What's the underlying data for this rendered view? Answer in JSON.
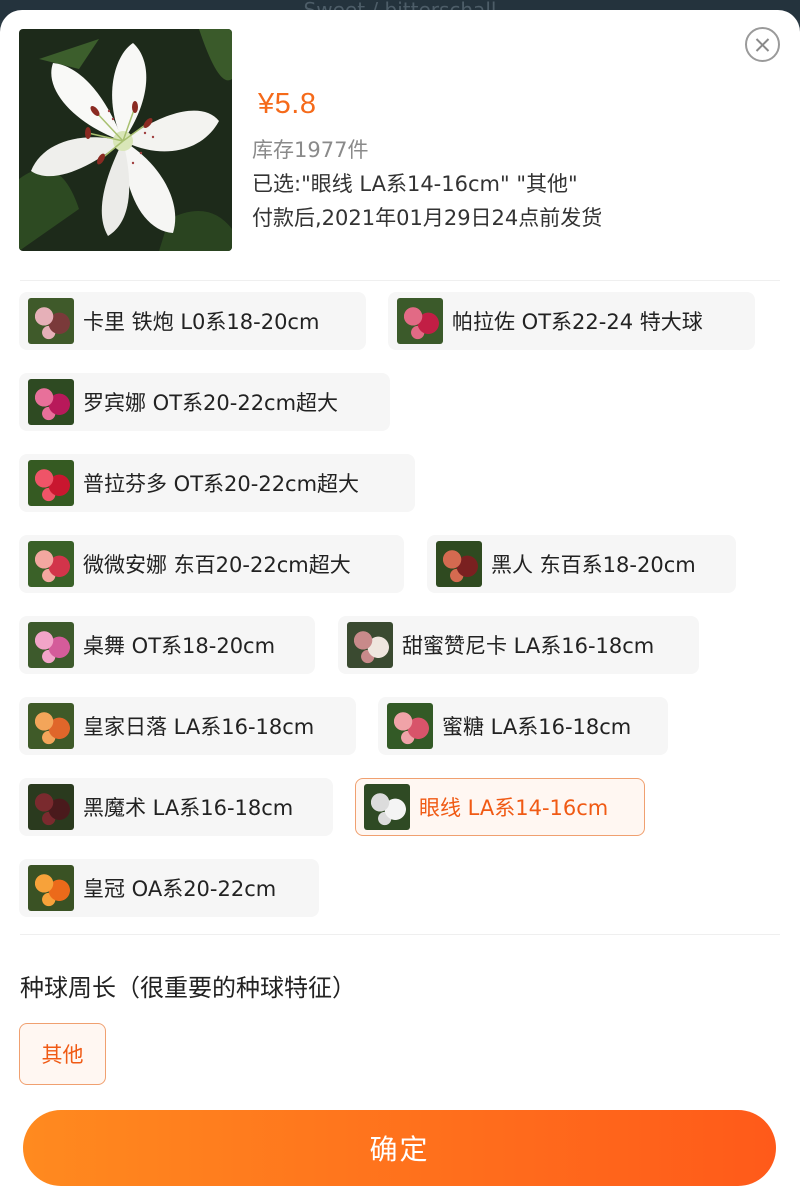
{
  "background": {
    "top_text": "Sweet / bitterschall"
  },
  "product": {
    "image": "white-lily-photo",
    "price": "¥5.8",
    "stock": "库存1977件",
    "selected": "已选:\"眼线 LA系14-16cm\" \"其他\"",
    "shipping": "付款后,2021年01月29日24点前发货"
  },
  "colors": {
    "accent": "#f56a1a",
    "selected_border": "#f0a070",
    "button_gradient_start": "#ff8a1f",
    "button_gradient_end": "#ff5a1a"
  },
  "variants": [
    {
      "label": "卡里 铁炮 L0系18-20cm",
      "swatch": [
        "#7a3a3a",
        "#e6b0b8",
        "#3f5a2a"
      ]
    },
    {
      "label": "帕拉佐 OT系22-24 特大球",
      "swatch": [
        "#c21e45",
        "#e26a85",
        "#3b5a2a"
      ]
    },
    {
      "label": "罗宾娜 OT系20-22cm超大",
      "swatch": [
        "#b8195a",
        "#e8709a",
        "#2e4a22"
      ]
    },
    {
      "label": "普拉芬多 OT系20-22cm超大",
      "swatch": [
        "#c9162f",
        "#ef5468",
        "#355a22"
      ]
    },
    {
      "label": "微微安娜 东百20-22cm超大",
      "swatch": [
        "#d2344a",
        "#f3a7a0",
        "#3a6128"
      ]
    },
    {
      "label": "黑人 东百系18-20cm",
      "swatch": [
        "#7a2020",
        "#d46a50",
        "#2f4a20"
      ]
    },
    {
      "label": "桌舞 OT系18-20cm",
      "swatch": [
        "#d45c9a",
        "#f2a4c8",
        "#3d5a2c"
      ]
    },
    {
      "label": "甜蜜赞尼卡 LA系16-18cm",
      "swatch": [
        "#efe6de",
        "#c88a8a",
        "#3a4a30"
      ]
    },
    {
      "label": "皇家日落 LA系16-18cm",
      "swatch": [
        "#e0662a",
        "#f3a55a",
        "#3f5a28"
      ]
    },
    {
      "label": "蜜糖 LA系16-18cm",
      "swatch": [
        "#d8546a",
        "#f0a3a8",
        "#335a26"
      ]
    },
    {
      "label": "黑魔术 LA系16-18cm",
      "swatch": [
        "#4a1a1c",
        "#7a2a2e",
        "#2a3a1e"
      ]
    },
    {
      "label": "眼线 LA系14-16cm",
      "swatch": [
        "#f4f4f4",
        "#dcdcdc",
        "#2f4a24"
      ],
      "selected": true
    },
    {
      "label": "皇冠 OA系20-22cm",
      "swatch": [
        "#ec6a1a",
        "#f7a23a",
        "#3a5224"
      ]
    }
  ],
  "bulb_section": {
    "title": "种球周长（很重要的种球特征）",
    "option": "其他"
  },
  "confirm_button": "确定"
}
